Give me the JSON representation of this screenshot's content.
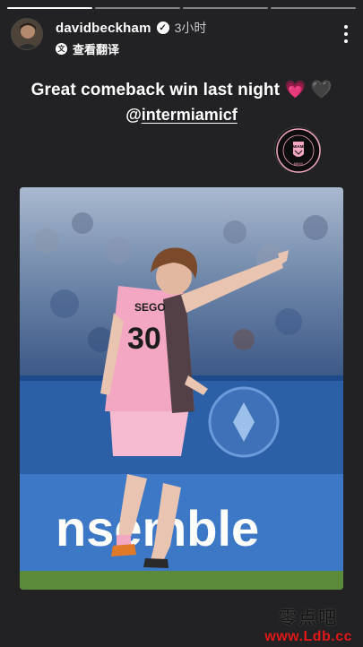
{
  "story": {
    "progress_segments": 4,
    "active_segment": 0
  },
  "header": {
    "username": "davidbeckham",
    "verified_icon": "verified-badge-icon",
    "time": "3小时",
    "translate_label": "查看翻译",
    "more_icon": "more-vertical-icon"
  },
  "caption": {
    "line1": "Great comeback win last night",
    "emoji1": "💗",
    "emoji2": "🖤",
    "line2_prefix": "@",
    "line2_handle": "intermiamicf"
  },
  "crest": {
    "icon": "inter-miami-crest-icon",
    "text_top": "MIAMI",
    "text_bottom": "MMXX",
    "ring_text": "CLUB INTERNACIONAL DE FÚTBOL"
  },
  "photo": {
    "jersey_name": "SEGO",
    "jersey_number": "30",
    "banner_text": "nsemble"
  },
  "watermark": {
    "cn": "零点吧",
    "url": "www.Ldb.cc"
  },
  "colors": {
    "background": "#222224",
    "jersey_pink": "#f3a7c2",
    "banner_blue": "#3d78c6",
    "watermark_red": "#e01818"
  }
}
